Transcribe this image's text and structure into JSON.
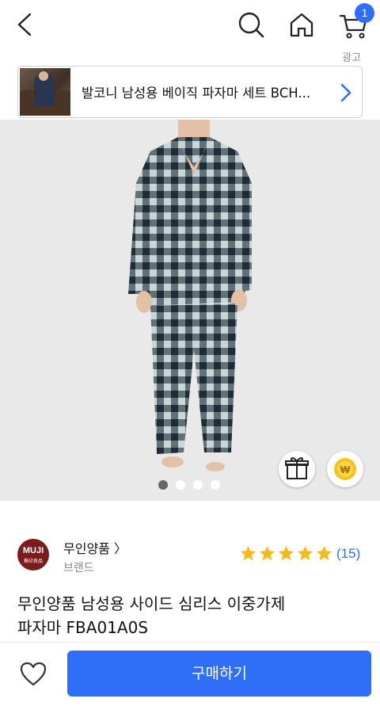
{
  "header": {
    "cart_count": "1",
    "icons": [
      "back-arrow-icon",
      "search-icon",
      "home-icon",
      "cart-icon"
    ]
  },
  "ad": {
    "tag": "광고",
    "text": "발코니 남성용 베이직 파자마 세트 BCH..."
  },
  "gallery": {
    "total_images": 4,
    "active_index": 0
  },
  "brand": {
    "logo_line1": "MUJI",
    "logo_line2": "無印良品",
    "name": "무인양품 〉",
    "subtitle": "브랜드",
    "logo_color": "#7b1c1c"
  },
  "rating": {
    "stars": 5,
    "count": "(15)",
    "star_color": "#f6b91c"
  },
  "product": {
    "title_line1": "무인양품 남성용 사이드 심리스 이중가제",
    "title_line2": "파자마 FBA01A0S"
  },
  "actions": {
    "buy_label": "구매하기",
    "accent_color": "#2f6ef6"
  }
}
